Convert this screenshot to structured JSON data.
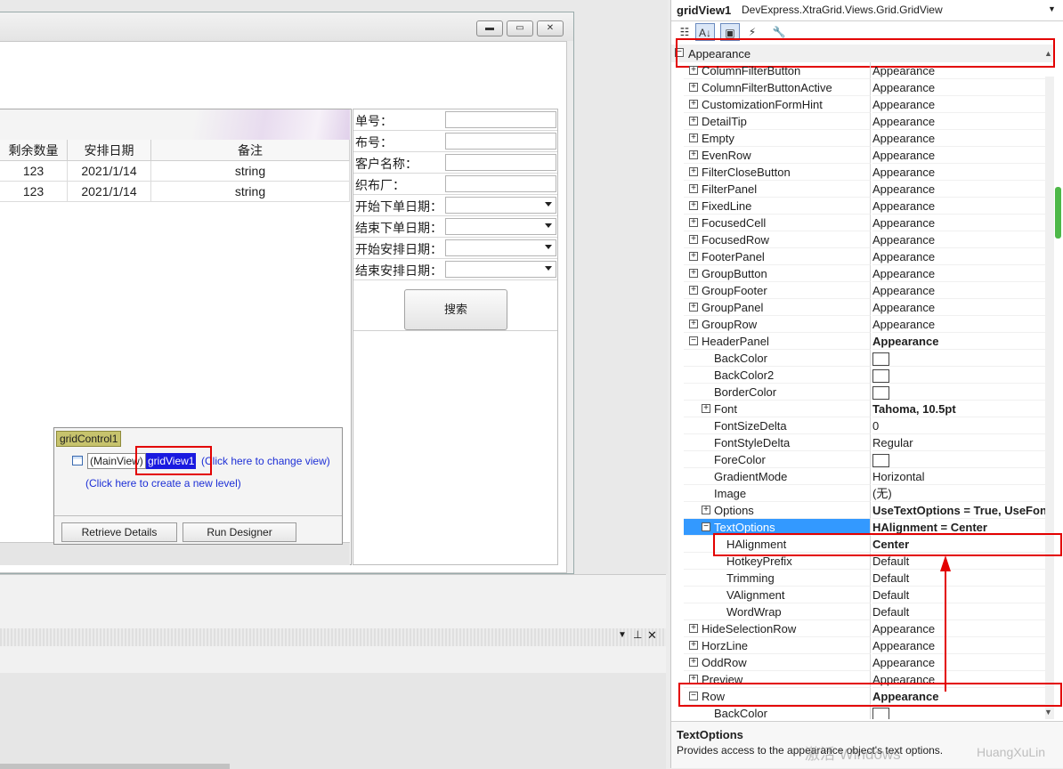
{
  "window": {
    "minimize_icon": "minimize-icon",
    "maximize_icon": "restore-icon",
    "close_icon": "close-icon"
  },
  "grid": {
    "columns": [
      "剩余数量",
      "安排日期",
      "备注"
    ],
    "rows": [
      [
        "123",
        "2021/1/14",
        "string"
      ],
      [
        "123",
        "2021/1/14",
        "string"
      ]
    ]
  },
  "filter": {
    "fields": [
      {
        "label": "单号："
      },
      {
        "label": "布号："
      },
      {
        "label": "客户名称："
      },
      {
        "label": "织布厂："
      },
      {
        "label": "开始下单日期："
      },
      {
        "label": "结束下单日期："
      },
      {
        "label": "开始安排日期："
      },
      {
        "label": "结束安排日期："
      }
    ],
    "search_label": "搜索"
  },
  "smarttag": {
    "title": "gridControl1",
    "mainview": "(MainView)",
    "view_name": "gridView1",
    "change_view": "(Click here to change view)",
    "new_level": "(Click here to create a new level)",
    "retrieve": "Retrieve Details",
    "designer": "Run Designer"
  },
  "properties": {
    "object_name": "gridView1",
    "object_type": "DevExpress.XtraGrid.Views.Grid.GridView",
    "category": "Appearance",
    "items": [
      {
        "name": "ColumnFilterButton",
        "value": "Appearance",
        "exp": "+",
        "indent": 0
      },
      {
        "name": "ColumnFilterButtonActive",
        "value": "Appearance",
        "exp": "+",
        "indent": 0
      },
      {
        "name": "CustomizationFormHint",
        "value": "Appearance",
        "exp": "+",
        "indent": 0
      },
      {
        "name": "DetailTip",
        "value": "Appearance",
        "exp": "+",
        "indent": 0
      },
      {
        "name": "Empty",
        "value": "Appearance",
        "exp": "+",
        "indent": 0
      },
      {
        "name": "EvenRow",
        "value": "Appearance",
        "exp": "+",
        "indent": 0
      },
      {
        "name": "FilterCloseButton",
        "value": "Appearance",
        "exp": "+",
        "indent": 0
      },
      {
        "name": "FilterPanel",
        "value": "Appearance",
        "exp": "+",
        "indent": 0
      },
      {
        "name": "FixedLine",
        "value": "Appearance",
        "exp": "+",
        "indent": 0
      },
      {
        "name": "FocusedCell",
        "value": "Appearance",
        "exp": "+",
        "indent": 0
      },
      {
        "name": "FocusedRow",
        "value": "Appearance",
        "exp": "+",
        "indent": 0
      },
      {
        "name": "FooterPanel",
        "value": "Appearance",
        "exp": "+",
        "indent": 0
      },
      {
        "name": "GroupButton",
        "value": "Appearance",
        "exp": "+",
        "indent": 0
      },
      {
        "name": "GroupFooter",
        "value": "Appearance",
        "exp": "+",
        "indent": 0
      },
      {
        "name": "GroupPanel",
        "value": "Appearance",
        "exp": "+",
        "indent": 0
      },
      {
        "name": "GroupRow",
        "value": "Appearance",
        "exp": "+",
        "indent": 0
      },
      {
        "name": "HeaderPanel",
        "value": "Appearance",
        "exp": "-",
        "indent": 0,
        "bold": true
      },
      {
        "name": "BackColor",
        "value": "",
        "swatch": true,
        "indent": 1
      },
      {
        "name": "BackColor2",
        "value": "",
        "swatch": true,
        "indent": 1
      },
      {
        "name": "BorderColor",
        "value": "",
        "swatch": true,
        "indent": 1
      },
      {
        "name": "Font",
        "value": "Tahoma, 10.5pt",
        "exp": "+",
        "indent": 1,
        "bold": true
      },
      {
        "name": "FontSizeDelta",
        "value": "0",
        "indent": 1
      },
      {
        "name": "FontStyleDelta",
        "value": "Regular",
        "indent": 1
      },
      {
        "name": "ForeColor",
        "value": "",
        "swatch": true,
        "indent": 1
      },
      {
        "name": "GradientMode",
        "value": "Horizontal",
        "indent": 1
      },
      {
        "name": "Image",
        "value": "(无)",
        "indent": 1
      },
      {
        "name": "Options",
        "value": "UseTextOptions = True, UseFont",
        "exp": "+",
        "indent": 1,
        "bold": true
      },
      {
        "name": "TextOptions",
        "value": "HAlignment = Center",
        "exp": "-",
        "indent": 1,
        "bold": true,
        "selected": true
      },
      {
        "name": "HAlignment",
        "value": "Center",
        "indent": 2,
        "bold": true
      },
      {
        "name": "HotkeyPrefix",
        "value": "Default",
        "indent": 2
      },
      {
        "name": "Trimming",
        "value": "Default",
        "indent": 2
      },
      {
        "name": "VAlignment",
        "value": "Default",
        "indent": 2
      },
      {
        "name": "WordWrap",
        "value": "Default",
        "indent": 2
      },
      {
        "name": "HideSelectionRow",
        "value": "Appearance",
        "exp": "+",
        "indent": 0
      },
      {
        "name": "HorzLine",
        "value": "Appearance",
        "exp": "+",
        "indent": 0
      },
      {
        "name": "OddRow",
        "value": "Appearance",
        "exp": "+",
        "indent": 0
      },
      {
        "name": "Preview",
        "value": "Appearance",
        "exp": "+",
        "indent": 0
      },
      {
        "name": "Row",
        "value": "Appearance",
        "exp": "-",
        "indent": 0,
        "bold": true
      },
      {
        "name": "BackColor",
        "value": "",
        "swatch": true,
        "indent": 1
      }
    ],
    "desc_title": "TextOptions",
    "desc_text": "Provides access to the appearance object's text options.",
    "watermark": "激活 Windows",
    "watermark2": "HuangXuLin"
  },
  "colors": {
    "selected": "#3399ff",
    "highlight": "#e30000",
    "link": "#1d2fd6"
  }
}
